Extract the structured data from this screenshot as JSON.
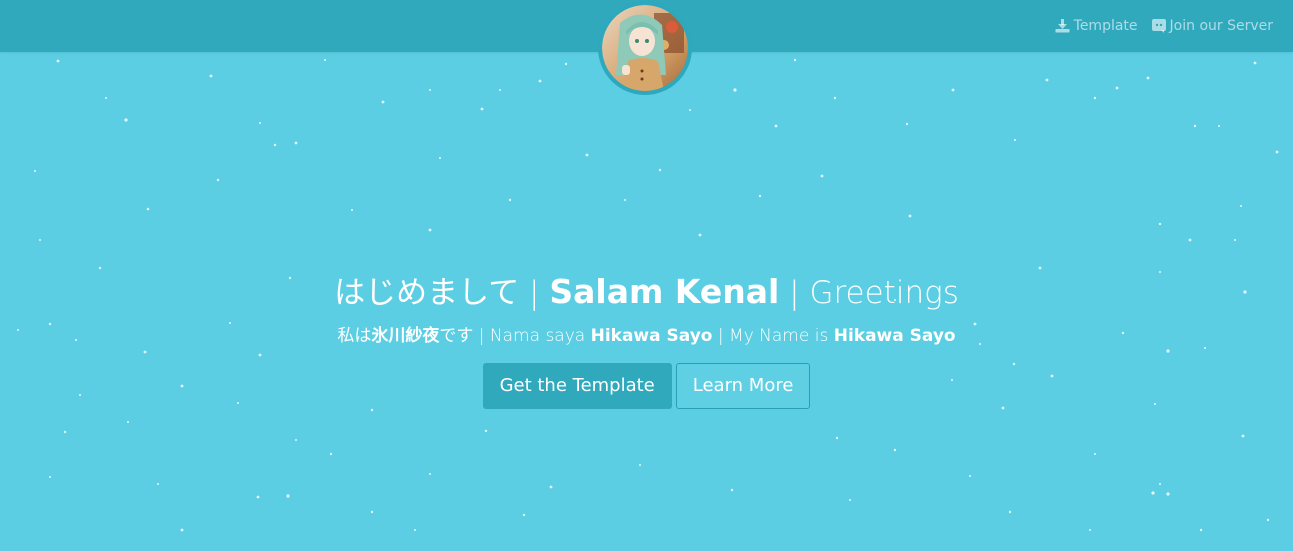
{
  "navbar": {
    "links": [
      {
        "label": "Template",
        "icon": "download-icon"
      },
      {
        "label": "Join our Server",
        "icon": "discord-icon"
      }
    ]
  },
  "avatar": {
    "icon": "profile-avatar-image"
  },
  "hero": {
    "title": {
      "part1": "はじめまして",
      "sep1": " | ",
      "part2": "Salam Kenal",
      "sep2": " | ",
      "part3": "Greetings"
    },
    "subtitle": {
      "ja_prefix": "私は",
      "ja_name": "氷川紗夜",
      "ja_suffix": "です",
      "sep1": " | ",
      "id_prefix": "Nama saya ",
      "id_name": "Hikawa Sayo",
      "sep2": " | ",
      "en_prefix": "My Name is ",
      "en_name": "Hikawa Sayo"
    },
    "buttons": {
      "primary": "Get the Template",
      "secondary": "Learn More"
    }
  },
  "colors": {
    "background": "#5bcee3",
    "navbar": "#30a9bd",
    "primary_button": "#30a9bd",
    "text": "#ffffff"
  }
}
